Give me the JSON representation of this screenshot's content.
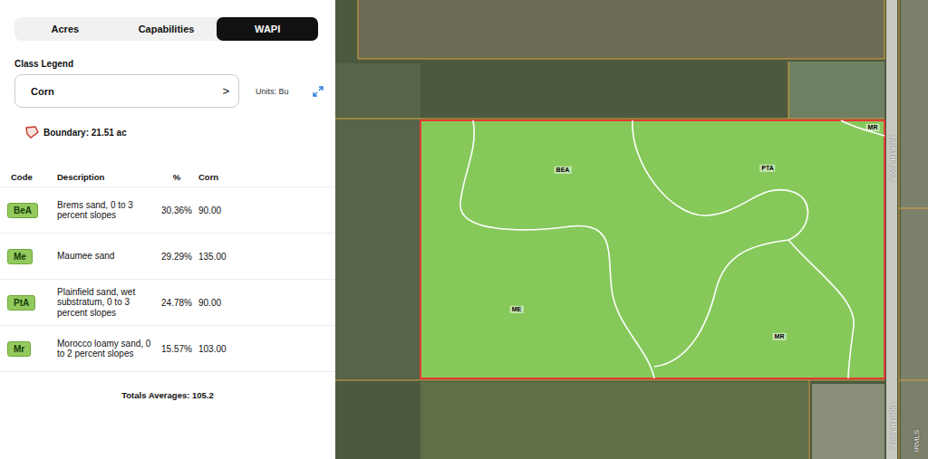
{
  "tabs": [
    {
      "label": "Acres",
      "selected": false
    },
    {
      "label": "Capabilities",
      "selected": false
    },
    {
      "label": "WAPI",
      "selected": true
    }
  ],
  "legend": {
    "title": "Class Legend",
    "value": "Corn",
    "chevron": ">",
    "units": "Units: Bu"
  },
  "boundary": {
    "label": "Boundary: 21.51 ac"
  },
  "table": {
    "columns": [
      "Code",
      "Description",
      "%",
      "Corn"
    ],
    "rows": [
      {
        "code": "BeA",
        "description": "Brems sand, 0 to 3 percent slopes",
        "percent": "30.36%",
        "corn": "90.00"
      },
      {
        "code": "Me",
        "description": "Maumee sand",
        "percent": "29.29%",
        "corn": "135.00"
      },
      {
        "code": "PtA",
        "description": "Plainfield sand, wet substratum, 0 to 3 percent slopes",
        "percent": "24.78%",
        "corn": "90.00"
      },
      {
        "code": "Mr",
        "description": "Morocco loamy sand, 0 to 2 percent slopes",
        "percent": "15.57%",
        "corn": "103.00"
      }
    ]
  },
  "totals": "Totals Averages: 105.2",
  "map": {
    "labels": [
      "MR",
      "BEA",
      "PTA",
      "ME",
      "MR"
    ],
    "road_labels": [
      "NORTH 500 E",
      "NORTH 500 E"
    ],
    "watermark": "IRMLS"
  }
}
